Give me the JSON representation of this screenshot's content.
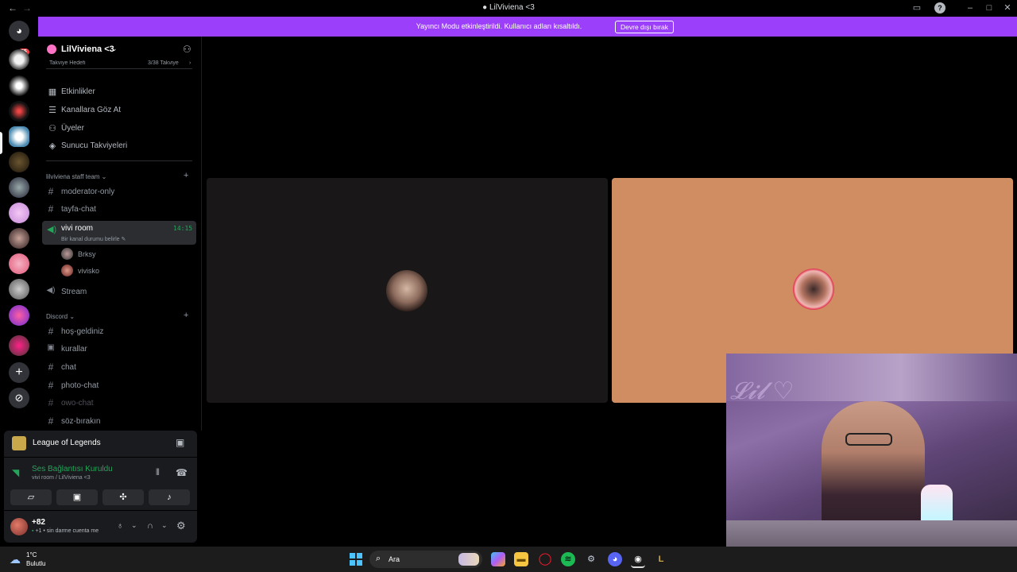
{
  "window": {
    "title": "LilViviena <3",
    "back": "←",
    "forward": "→"
  },
  "banner": {
    "text": "Yayıncı Modu etkinleştirildi. Kullanıcı adları kısaltıldı.",
    "button": "Devre dışı bırak",
    "accent": "#9b3ffb"
  },
  "server_rail": {
    "home_badge": "55",
    "add_server": "+"
  },
  "sidebar": {
    "server_name": "LilViviena <3",
    "boost_goal": "Takviye Hedefi",
    "boost_count": "3/38 Takviye",
    "menu": [
      {
        "label": "Etkinlikler"
      },
      {
        "label": "Kanallara Göz At"
      },
      {
        "label": "Üyeler"
      },
      {
        "label": "Sunucu Takviyeleri"
      }
    ],
    "category_staff": "lilviviena staff team",
    "staff_channels": [
      "moderator-only",
      "tayfa-chat"
    ],
    "voice_room": {
      "name": "vivi room",
      "time": "14:15",
      "status": "Bir kanal durumu belirle"
    },
    "voice_users": [
      "Brksy",
      "vivisko"
    ],
    "stream_channel": "Stream",
    "category_discord": "Discord",
    "discord_channels": [
      "hoş-geldiniz",
      "kurallar",
      "chat",
      "photo-chat",
      "owo-chat",
      "söz-bırakın"
    ]
  },
  "game_card": {
    "name": "League of Legends"
  },
  "voice_card": {
    "title": "Ses Bağlantısı Kuruldu",
    "subtitle": "vivi room / LilViviena <3"
  },
  "user_panel": {
    "name": "+82",
    "status": "+1 • sin darme cuenta me"
  },
  "taskbar": {
    "temp": "1°C",
    "weather": "Bulutlu",
    "search": "Ara"
  }
}
